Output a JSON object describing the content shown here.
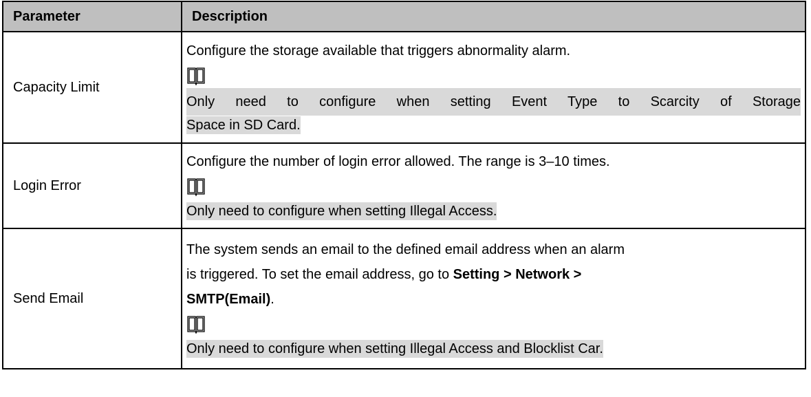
{
  "header": {
    "col1": "Parameter",
    "col2": "Description"
  },
  "rows": [
    {
      "param": "Capacity Limit",
      "desc": "Configure the storage available that triggers abnormality alarm.",
      "note_line1": "Only need to configure when setting Event Type to Scarcity of Storage",
      "note_line2": "Space in SD Card."
    },
    {
      "param": "Login Error",
      "desc": "Configure the number of login error allowed. The range is 3–10 times.",
      "note": "Only need to configure when setting Illegal Access."
    },
    {
      "param": "Send Email",
      "desc_line1": "The system sends an email to the defined email address when an alarm",
      "desc_line2_a": "is triggered. To set the email address, go to ",
      "desc_line2_b": "Setting > Network >",
      "desc_line3_b": "SMTP(Email)",
      "desc_line3_c": ".",
      "note": "Only need to configure when setting Illegal Access and Blocklist Car."
    }
  ],
  "icons": {
    "note": "book-icon"
  }
}
